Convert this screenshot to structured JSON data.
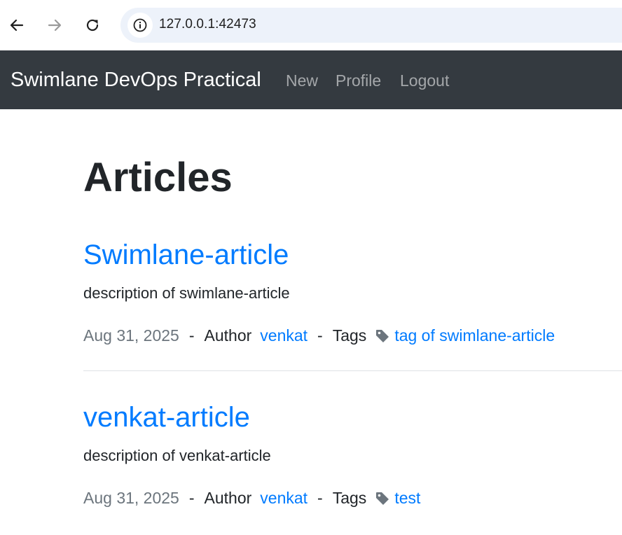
{
  "browser": {
    "url": "127.0.0.1:42473",
    "icons": {
      "back": "back-arrow-icon",
      "forward": "forward-arrow-icon",
      "reload": "reload-icon",
      "site_info": "info-icon"
    }
  },
  "navbar": {
    "brand": "Swimlane DevOps Practical",
    "links": [
      "New",
      "Profile",
      "Logout"
    ],
    "background": "#343a40"
  },
  "main": {
    "title": "Articles",
    "articles": [
      {
        "title": "Swimlane-article",
        "description": "description of swimlane-article",
        "date": "Aug 31, 2025",
        "author_label": "Author",
        "author": "venkat",
        "tags_label": "Tags",
        "tag_icon": "tag-icon",
        "tags": "tag of swimlane-article"
      },
      {
        "title": "venkat-article",
        "description": "description of venkat-article",
        "date": "Aug 31, 2025",
        "author_label": "Author",
        "author": "venkat",
        "tags_label": "Tags",
        "tag_icon": "tag-icon",
        "tags": "test"
      }
    ],
    "separator": "-"
  },
  "colors": {
    "link": "#007bff",
    "muted": "#6c757d",
    "text": "#212529"
  }
}
